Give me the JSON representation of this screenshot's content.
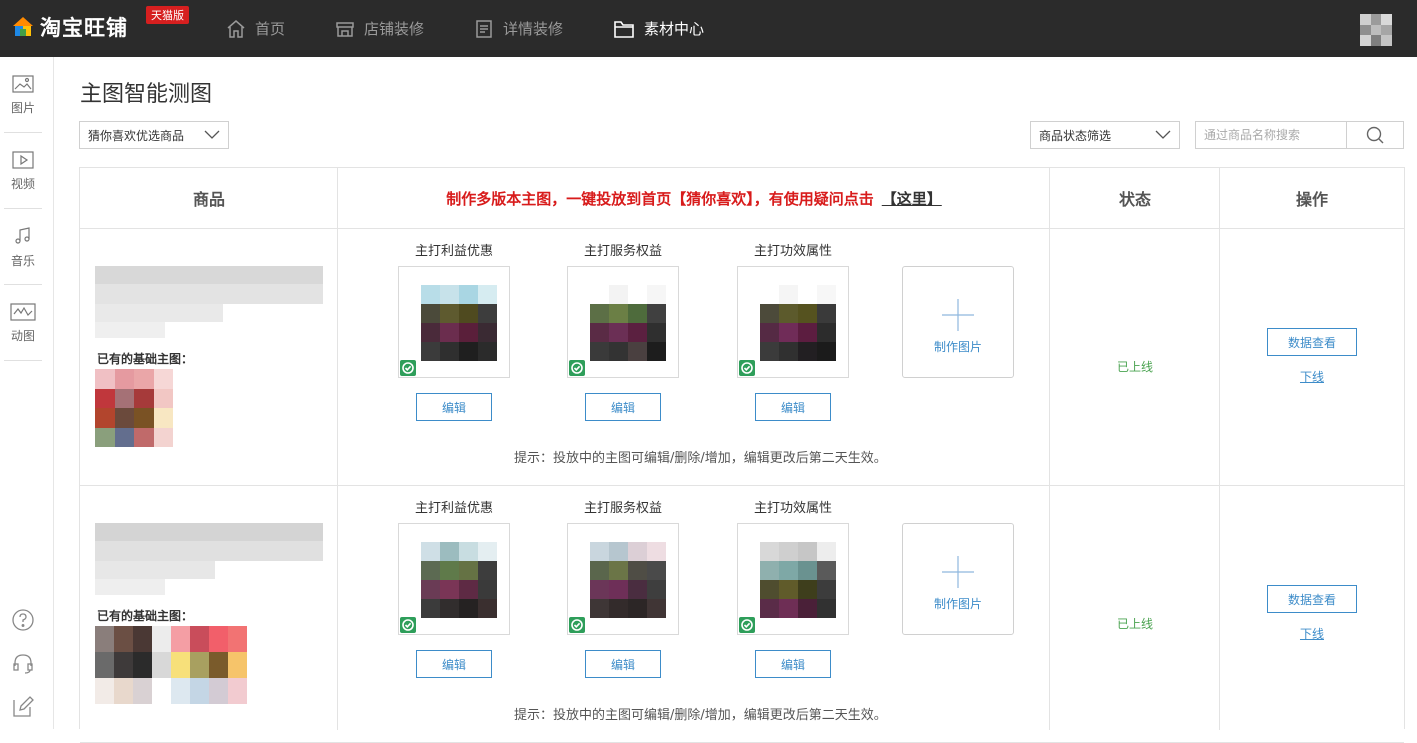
{
  "app": {
    "logo_text": "淘宝旺铺",
    "logo_badge": "天猫版"
  },
  "nav": [
    {
      "label": "首页",
      "icon": "home-icon",
      "active": false
    },
    {
      "label": "店铺装修",
      "icon": "store-icon",
      "active": false
    },
    {
      "label": "详情装修",
      "icon": "document-icon",
      "active": false
    },
    {
      "label": "素材中心",
      "icon": "folder-icon",
      "active": true
    }
  ],
  "sidebar": [
    {
      "label": "图片",
      "icon": "image-icon"
    },
    {
      "label": "视频",
      "icon": "video-icon"
    },
    {
      "label": "音乐",
      "icon": "music-icon"
    },
    {
      "label": "动图",
      "icon": "gif-icon"
    }
  ],
  "sidebar_bottom": [
    "help-icon",
    "headset-icon",
    "edit-icon"
  ],
  "page": {
    "title": "主图智能测图"
  },
  "filters": {
    "left_select": "猜你喜欢优选商品",
    "status_select": "商品状态筛选",
    "search_placeholder": "通过商品名称搜索"
  },
  "table": {
    "col_product": "商品",
    "promo_text": "制作多版本主图，一键投放到首页【猜你喜欢】，有使用疑问点击",
    "promo_link": "【这里】",
    "col_status": "状态",
    "col_action": "操作"
  },
  "rows": [
    {
      "base_label": "已有的基础主图：",
      "versions": [
        {
          "label": "主打利益优惠",
          "edit": "编辑"
        },
        {
          "label": "主打服务权益",
          "edit": "编辑"
        },
        {
          "label": "主打功效属性",
          "edit": "编辑"
        }
      ],
      "make_label": "制作图片",
      "hint": "提示：投放中的主图可编辑/删除/增加，编辑更改后第二天生效。",
      "status": "已上线",
      "data_btn": "数据查看",
      "offline": "下线"
    },
    {
      "base_label": "已有的基础主图：",
      "versions": [
        {
          "label": "主打利益优惠",
          "edit": "编辑"
        },
        {
          "label": "主打服务权益",
          "edit": "编辑"
        },
        {
          "label": "主打功效属性",
          "edit": "编辑"
        }
      ],
      "make_label": "制作图片",
      "hint": "提示：投放中的主图可编辑/删除/增加，编辑更改后第二天生效。",
      "status": "已上线",
      "data_btn": "数据查看",
      "offline": "下线"
    }
  ],
  "colors": {
    "accent": "#3d8cc9",
    "promo_red": "#d81b1b",
    "online_green": "#4aa350",
    "topbar": "#2b2b2b"
  }
}
